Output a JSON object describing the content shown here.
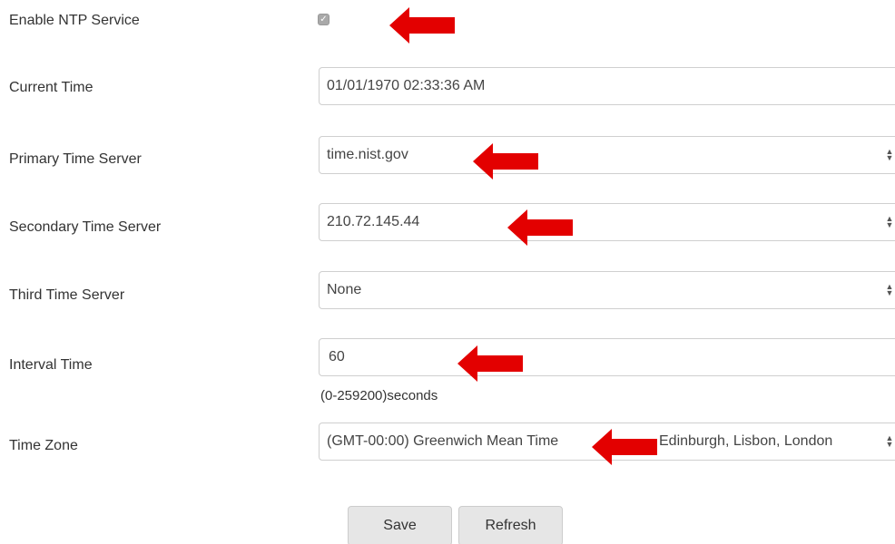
{
  "form": {
    "enable_ntp": {
      "label": "Enable NTP Service",
      "checked": true
    },
    "current_time": {
      "label": "Current Time",
      "value": "01/01/1970 02:33:36 AM"
    },
    "primary_server": {
      "label": "Primary Time Server",
      "value": "time.nist.gov"
    },
    "secondary_server": {
      "label": "Secondary Time Server",
      "value": "210.72.145.44"
    },
    "third_server": {
      "label": "Third Time Server",
      "value": "None"
    },
    "interval": {
      "label": "Interval Time",
      "value": "60",
      "hint": "(0-259200)seconds"
    },
    "time_zone": {
      "label": "Time Zone",
      "value_part1": "(GMT-00:00) Greenwich Mean Time",
      "value_part2": "Edinburgh, Lisbon, London"
    }
  },
  "buttons": {
    "save": "Save",
    "refresh": "Refresh"
  },
  "colors": {
    "annotation_arrow": "#e30000",
    "button_bg": "#e6e6e6",
    "field_border": "#cfcfcf"
  },
  "icons": {
    "checkbox": "checkmark-icon",
    "select": "updown-chevron-icon",
    "annotation": "red-arrow-icon"
  }
}
